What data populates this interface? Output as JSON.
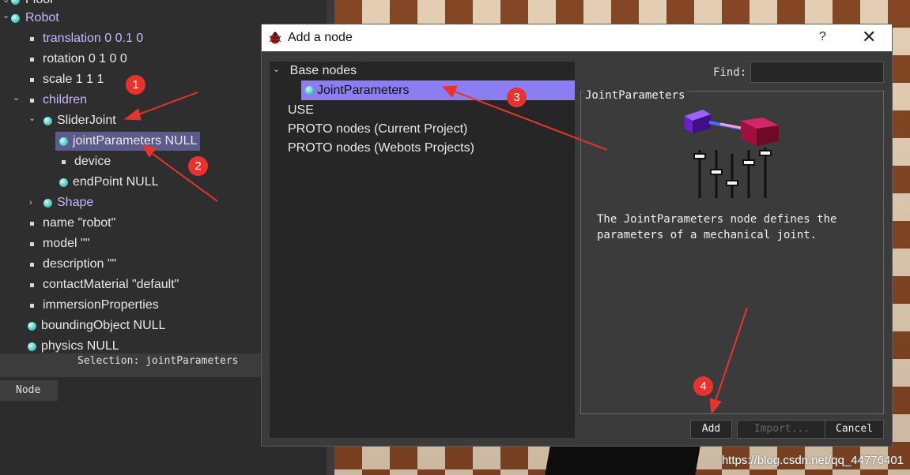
{
  "scene_tree": {
    "items": [
      {
        "label": "Floor"
      },
      {
        "label": "Robot"
      },
      {
        "label": "translation 0 0.1 0"
      },
      {
        "label": "rotation 0 1 0 0"
      },
      {
        "label": "scale 1 1 1"
      },
      {
        "label": "children"
      },
      {
        "label": "SliderJoint"
      },
      {
        "label": "jointParameters NULL"
      },
      {
        "label": "device"
      },
      {
        "label": "endPoint NULL"
      },
      {
        "label": "Shape"
      },
      {
        "label": "name \"robot\""
      },
      {
        "label": "model \"\""
      },
      {
        "label": "description \"\""
      },
      {
        "label": "contactMaterial \"default\""
      },
      {
        "label": "immersionProperties"
      },
      {
        "label": "boundingObject NULL"
      },
      {
        "label": "physics NULL"
      }
    ],
    "selection_text": "Selection: jointParameters",
    "tab_label": "Node"
  },
  "dialog": {
    "title": "Add a node",
    "help_label": "?",
    "close_label": "✕",
    "list": {
      "base_nodes": "Base nodes",
      "selected_item": "JointParameters",
      "use": "USE",
      "proto_current": "PROTO nodes (Current Project)",
      "proto_webots": "PROTO nodes (Webots Projects)"
    },
    "find_label": "Find:",
    "find_value": "",
    "info_title": "JointParameters",
    "description": "The JointParameters node defines the parameters of a mechanical joint.",
    "buttons": {
      "add": "Add",
      "import": "Import...",
      "cancel": "Cancel"
    }
  },
  "annotations": {
    "badges": [
      "1",
      "2",
      "3",
      "4"
    ],
    "color": "#e8322d"
  },
  "watermark": "https://blog.csdn.net/qq_44776401",
  "icons": [
    "bug-icon",
    "node-dot-icon",
    "field-square-icon",
    "expand-arrow-icon",
    "joint-parameters-icon"
  ]
}
